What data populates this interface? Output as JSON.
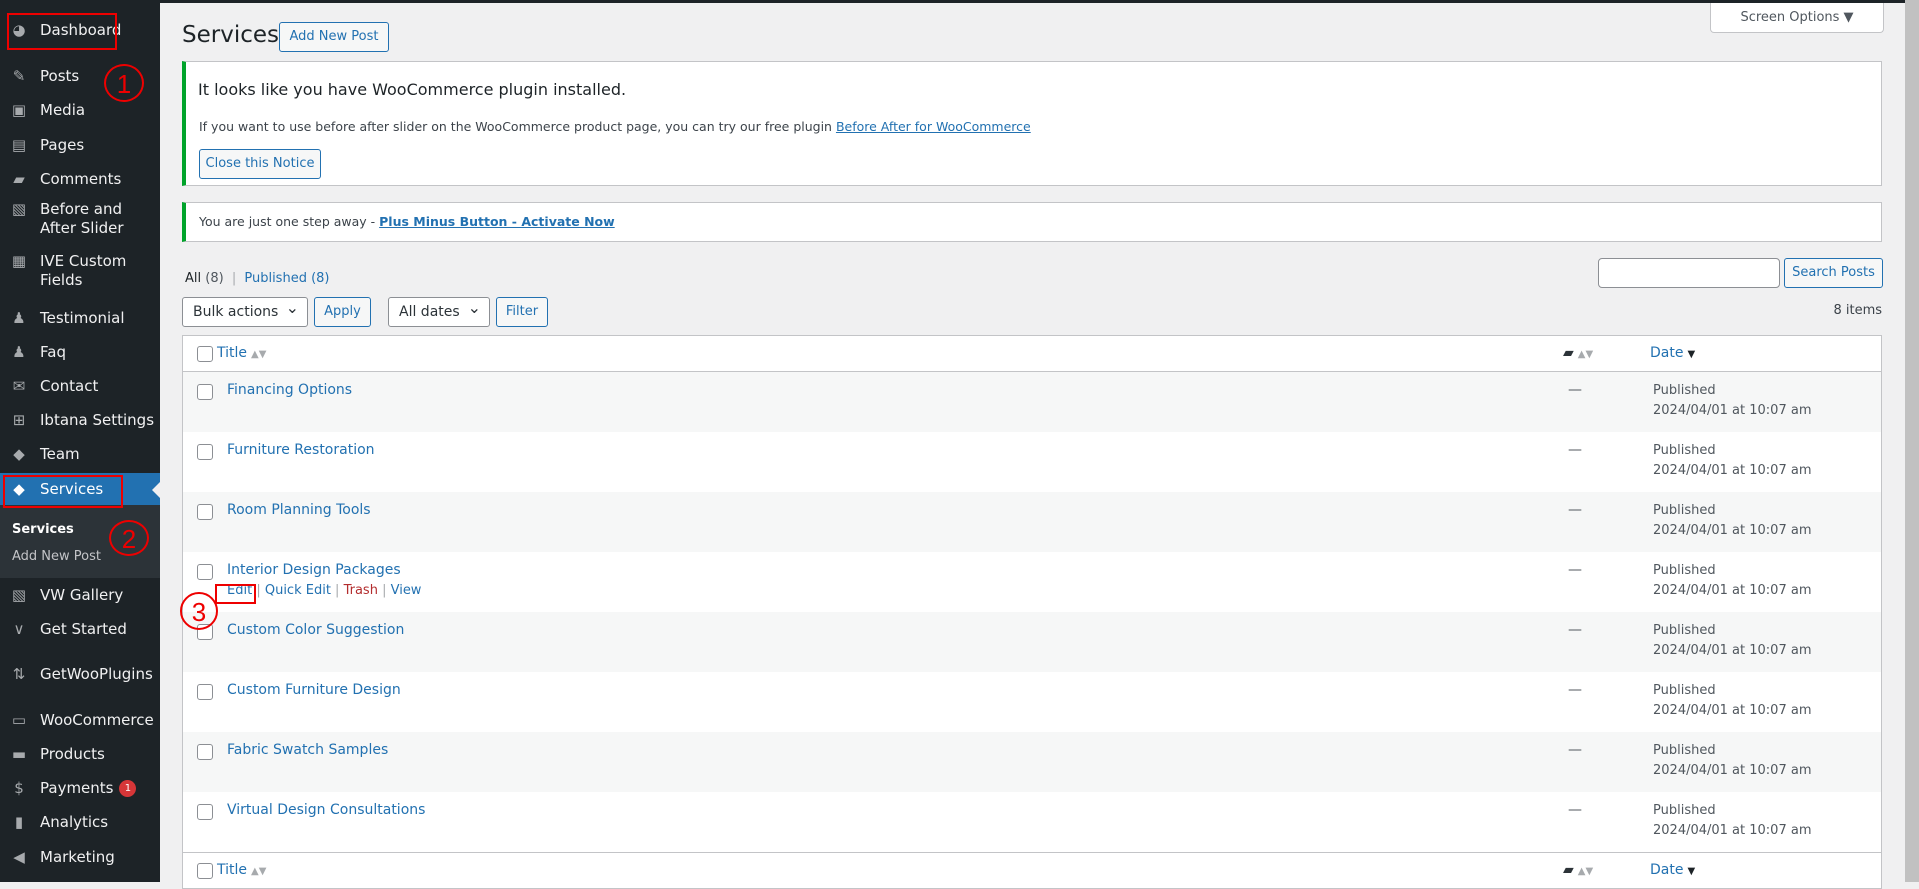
{
  "sidebar": {
    "items": [
      {
        "label": "Dashboard",
        "icon": "dashboard-icon",
        "glyph": "◕"
      },
      {
        "label": "Posts",
        "icon": "pin-icon",
        "glyph": "✎"
      },
      {
        "label": "Media",
        "icon": "media-icon",
        "glyph": "▣"
      },
      {
        "label": "Pages",
        "icon": "pages-icon",
        "glyph": "▤"
      },
      {
        "label": "Comments",
        "icon": "comment-icon",
        "glyph": "▰"
      },
      {
        "label": "Before and After Slider",
        "icon": "image-icon",
        "glyph": "▧"
      },
      {
        "label": "IVE Custom Fields",
        "icon": "grid-icon",
        "glyph": "▦"
      },
      {
        "label": "Testimonial",
        "icon": "user-icon",
        "glyph": "♟"
      },
      {
        "label": "Faq",
        "icon": "user-icon",
        "glyph": "♟"
      },
      {
        "label": "Contact",
        "icon": "mail-icon",
        "glyph": "✉"
      },
      {
        "label": "Ibtana Settings",
        "icon": "settings-icon",
        "glyph": "⊞"
      },
      {
        "label": "Team",
        "icon": "tag-icon",
        "glyph": "◆"
      },
      {
        "label": "Services",
        "icon": "tag-icon",
        "glyph": "◆"
      },
      {
        "label": "VW Gallery",
        "icon": "gallery-icon",
        "glyph": "▧"
      },
      {
        "label": "Get Started",
        "icon": "chevron-icon",
        "glyph": "∨"
      },
      {
        "label": "GetWooPlugins",
        "icon": "plugins-icon",
        "glyph": "⇅"
      },
      {
        "label": "WooCommerce",
        "icon": "woo-icon",
        "glyph": "▭"
      },
      {
        "label": "Products",
        "icon": "archive-icon",
        "glyph": "▬"
      },
      {
        "label": "Payments",
        "icon": "dollar-icon",
        "glyph": "$",
        "badge": "1"
      },
      {
        "label": "Analytics",
        "icon": "chart-icon",
        "glyph": "▮"
      },
      {
        "label": "Marketing",
        "icon": "megaphone-icon",
        "glyph": "◀"
      }
    ],
    "submenu": [
      "Services",
      "Add New Post"
    ]
  },
  "annotations": [
    "1",
    "2",
    "3"
  ],
  "header": {
    "title": "Services",
    "add_new": "Add New Post",
    "screen_options": "Screen Options ▼"
  },
  "notice1": {
    "title": "It looks like you have WooCommerce plugin installed.",
    "text": "If you want to use before after slider on the WooCommerce product page, you can try our free plugin ",
    "link": "Before After for WooCommerce",
    "button": "Close this Notice"
  },
  "notice2": {
    "text": "You are just one step away - ",
    "link": "Plus Minus Button - Activate Now"
  },
  "filters": {
    "all": "All",
    "all_count": "(8)",
    "sep": "|",
    "published": "Published",
    "published_count": "(8)",
    "bulk": "Bulk actions",
    "apply": "Apply",
    "dates": "All dates",
    "filter": "Filter",
    "search_placeholder": "",
    "search_button": "Search Posts",
    "count": "8 items"
  },
  "table": {
    "col_title": "Title",
    "col_date": "Date",
    "dash": "—",
    "row_actions": {
      "edit": "Edit",
      "quick_edit": "Quick Edit",
      "trash": "Trash",
      "view": "View"
    },
    "rows": [
      {
        "title": "Financing Options",
        "status": "Published",
        "date": "2024/04/01 at 10:07 am"
      },
      {
        "title": "Furniture Restoration",
        "status": "Published",
        "date": "2024/04/01 at 10:07 am"
      },
      {
        "title": "Room Planning Tools",
        "status": "Published",
        "date": "2024/04/01 at 10:07 am"
      },
      {
        "title": "Interior Design Packages",
        "status": "Published",
        "date": "2024/04/01 at 10:07 am",
        "actions": true
      },
      {
        "title": "Custom Color Suggestion",
        "status": "Published",
        "date": "2024/04/01 at 10:07 am"
      },
      {
        "title": "Custom Furniture Design",
        "status": "Published",
        "date": "2024/04/01 at 10:07 am"
      },
      {
        "title": "Fabric Swatch Samples",
        "status": "Published",
        "date": "2024/04/01 at 10:07 am"
      },
      {
        "title": "Virtual Design Consultations",
        "status": "Published",
        "date": "2024/04/01 at 10:07 am"
      }
    ]
  }
}
